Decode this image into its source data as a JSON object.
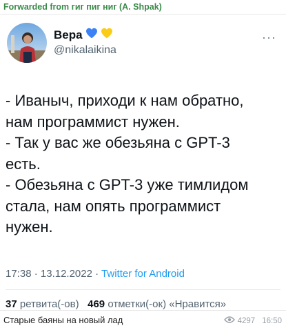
{
  "message": {
    "forwarded_from": "Forwarded from гиг пиг ниг (A. Shpak)",
    "caption": "Старые баяны на новый лад",
    "views": "4297",
    "time": "16:50"
  },
  "tweet": {
    "author_name": "Вера",
    "author_handle": "@nikalaikina",
    "name_emojis": [
      "blue-heart-icon",
      "yellow-heart-icon"
    ],
    "lines": [
      "- Иваныч, приходи к нам обратно,",
      "нам программист нужен.",
      "- Так у вас же обезьяна с GPT-3",
      "есть.",
      "- Обезьяна с GPT-3 уже тимлидом",
      "стала, нам опять программист",
      "нужен."
    ],
    "time": "17:38",
    "separator": "·",
    "date": "13.12.2022",
    "source": "Twitter for Android",
    "retweets_count": "37",
    "retweets_label": "ретвита(-ов)",
    "likes_count": "469",
    "likes_label": "отметки(-ок) «Нравится»"
  },
  "colors": {
    "forward_header": "#3a8a4a",
    "link": "#1d9bf0",
    "secondary_text": "#536471",
    "blue_heart": "#3b82f6",
    "yellow_heart": "#facc15"
  }
}
